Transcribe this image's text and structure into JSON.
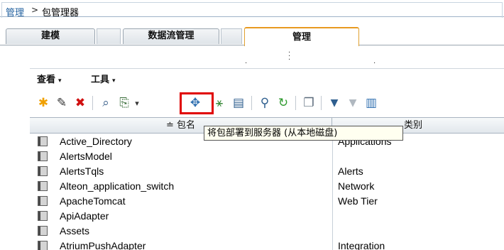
{
  "breadcrumb": {
    "root": "管理",
    "separator": ">",
    "current": "包管理器"
  },
  "tabs": [
    {
      "label": "建模"
    },
    {
      "label": "数据流管理"
    },
    {
      "label": "管理",
      "active": true
    }
  ],
  "menubar": {
    "view": "查看",
    "tools": "工具",
    "caret": "▾"
  },
  "toolbar": {
    "buttons": [
      {
        "name": "new-icon",
        "glyph": "✱",
        "color": "#f0a000"
      },
      {
        "name": "edit-icon",
        "glyph": "✎",
        "color": "#333333"
      },
      {
        "name": "delete-icon",
        "glyph": "✖",
        "color": "#d01010"
      },
      {
        "name": "view-icon",
        "glyph": "⌕",
        "color": "#3a5f8a"
      },
      {
        "name": "export-icon",
        "glyph": "⎘",
        "color": "#3a6e3a"
      },
      {
        "name": "dropdown-caret-icon",
        "glyph": "▾",
        "color": "#333333"
      },
      {
        "name": "deploy-icon",
        "glyph": "✥",
        "color": "#2f6fb0"
      },
      {
        "name": "undeploy-icon",
        "glyph": "⚹",
        "color": "#3a8a3a"
      },
      {
        "name": "zip-icon",
        "glyph": "▤",
        "color": "#2f5f8f"
      },
      {
        "name": "find-icon",
        "glyph": "⚲",
        "color": "#2f5f8f"
      },
      {
        "name": "refresh-icon",
        "glyph": "↻",
        "color": "#2e9a2e"
      },
      {
        "name": "copy-icon",
        "glyph": "❐",
        "color": "#5a6a7a"
      },
      {
        "name": "filter-icon",
        "glyph": "▼",
        "color": "#2f5f8f"
      },
      {
        "name": "clear-filter-icon",
        "glyph": "▼",
        "color": "#b0b8c0"
      },
      {
        "name": "columns-icon",
        "glyph": "▥",
        "color": "#2f6fb0"
      }
    ]
  },
  "tooltip": {
    "text": "将包部署到服务器 (从本地磁盘)"
  },
  "grid": {
    "headers": {
      "name": "≐ 包名",
      "category": "类别"
    },
    "rows": [
      {
        "name": "Active_Directory",
        "category": "Applications"
      },
      {
        "name": "AlertsModel",
        "category": ""
      },
      {
        "name": "AlertsTqls",
        "category": "Alerts"
      },
      {
        "name": "Alteon_application_switch",
        "category": "Network"
      },
      {
        "name": "ApacheTomcat",
        "category": "Web Tier"
      },
      {
        "name": "ApiAdapter",
        "category": ""
      },
      {
        "name": "Assets",
        "category": ""
      },
      {
        "name": "AtriumPushAdapter",
        "category": "Integration"
      }
    ]
  }
}
